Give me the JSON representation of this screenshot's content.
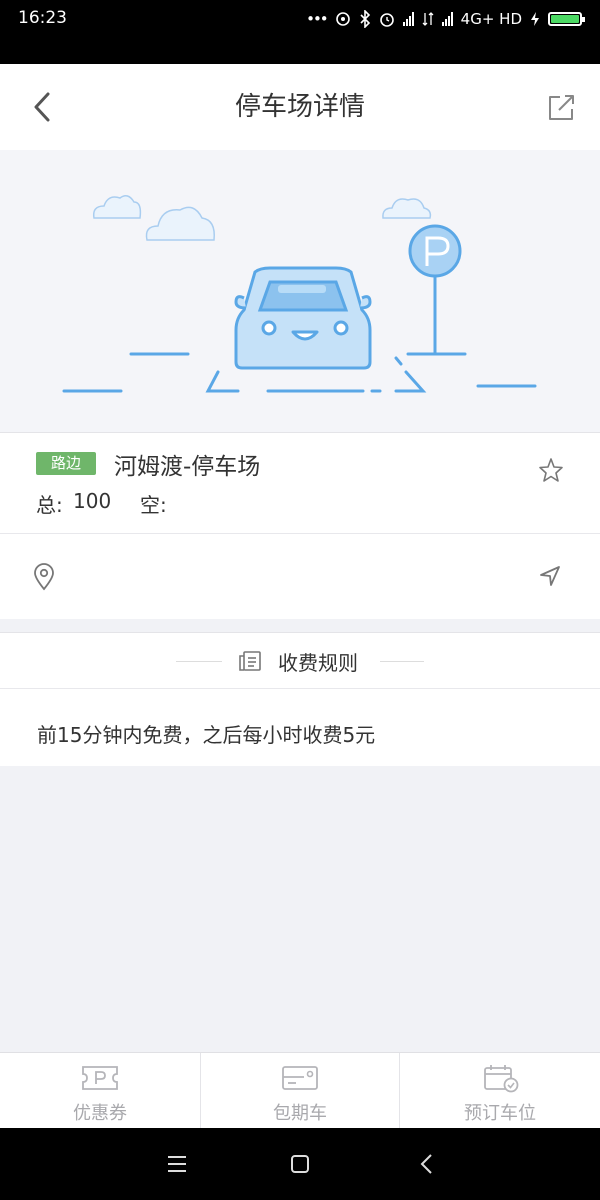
{
  "status_bar": {
    "time": "16:23",
    "dots": "•••",
    "network": "4G+ HD",
    "battery_level": 1.0,
    "icons": [
      "hotspot-icon",
      "bluetooth-icon",
      "alarm-icon",
      "signal-icon",
      "data-arrows-icon",
      "signal-icon",
      "charging-icon",
      "battery-icon"
    ]
  },
  "navbar": {
    "title": "停车场详情",
    "back_icon": "chevron-left-icon",
    "share_icon": "share-icon"
  },
  "lot": {
    "tag": "路边",
    "name": "河姆渡-停车场",
    "total_label": "总:",
    "total_value": "100",
    "free_label": "空:",
    "free_value": "",
    "address": ""
  },
  "rules": {
    "title": "收费规则",
    "text": "前15分钟内免费，之后每小时收费5元"
  },
  "tabs": [
    {
      "label": "优惠券",
      "icon": "coupon-icon"
    },
    {
      "label": "包期车",
      "icon": "card-icon"
    },
    {
      "label": "预订车位",
      "icon": "calendar-check-icon"
    }
  ],
  "colors": {
    "accent_blue": "#5aa7e6",
    "tag_green": "#6fb66a",
    "tab_gray": "#a9a9ad"
  }
}
